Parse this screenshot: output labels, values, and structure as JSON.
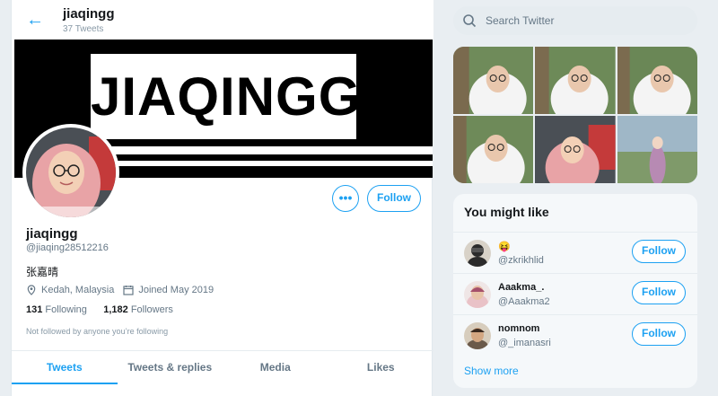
{
  "colors": {
    "accent": "#1da1f2",
    "muted": "#657786"
  },
  "header": {
    "back_icon": "back-arrow-icon",
    "name": "jiaqingg",
    "tweet_count": "37 Tweets"
  },
  "banner": {
    "text": "JIAQINGG"
  },
  "profile": {
    "name": "jiaqingg",
    "handle": "@jiaqing28512216",
    "bio": "张嘉晴",
    "location": "Kedah, Malaysia",
    "joined": "Joined May 2019",
    "following_count": "131",
    "following_label": "Following",
    "followers_count": "1,182",
    "followers_label": "Followers",
    "followed_by": "Not followed by anyone you’re following",
    "more_label": "•••",
    "follow_label": "Follow"
  },
  "tabs": [
    {
      "label": "Tweets",
      "active": true
    },
    {
      "label": "Tweets & replies",
      "active": false
    },
    {
      "label": "Media",
      "active": false
    },
    {
      "label": "Likes",
      "active": false
    }
  ],
  "search": {
    "placeholder": "Search Twitter",
    "value": ""
  },
  "suggestions": {
    "title": "You might like",
    "users": [
      {
        "name": "😝",
        "handle": "@zkrikhlid",
        "follow_label": "Follow"
      },
      {
        "name": "Aaakma_.",
        "handle": "@Aaakma2",
        "follow_label": "Follow"
      },
      {
        "name": "nomnom",
        "handle": "@_imanasri",
        "follow_label": "Follow"
      }
    ],
    "show_more": "Show more"
  }
}
